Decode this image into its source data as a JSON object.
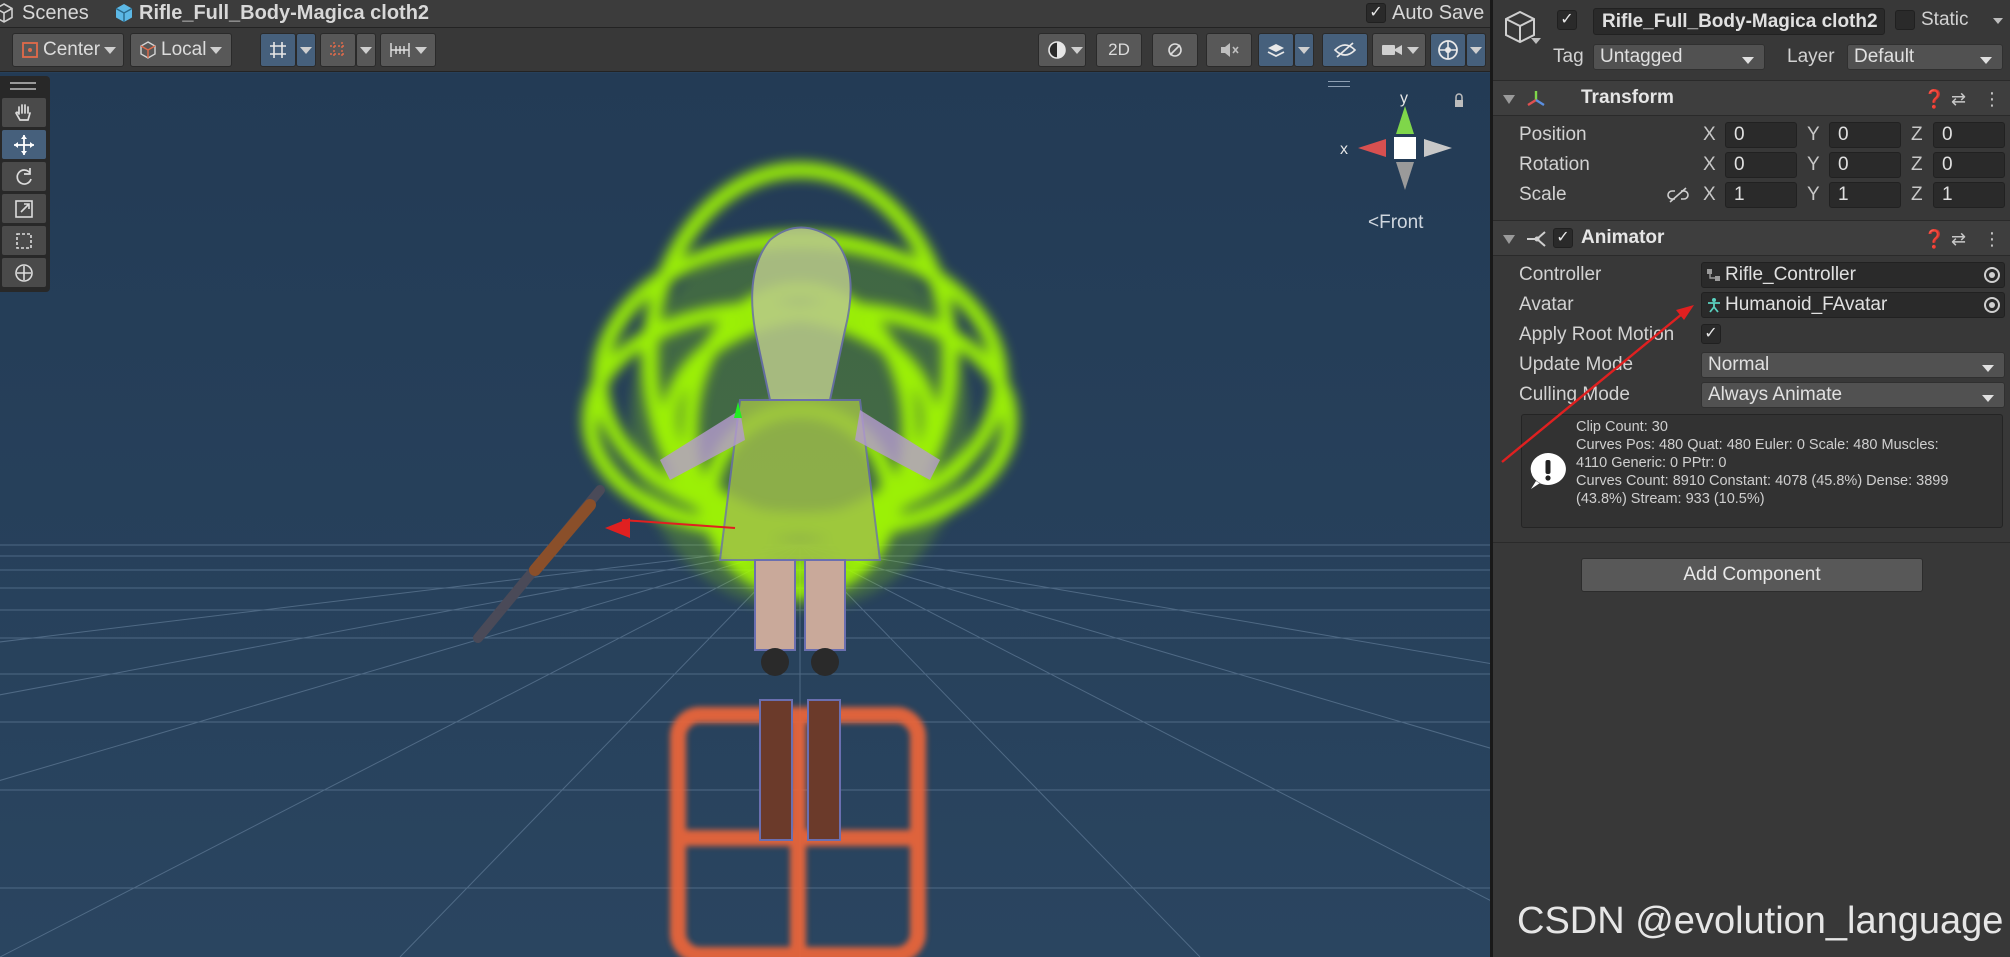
{
  "scene_header": {
    "tab_label": "Scenes",
    "object_label": "Rifle_Full_Body-Magica cloth2",
    "auto_save_label": "Auto Save",
    "auto_save_checked": true
  },
  "scene_toolbar": {
    "pivot_label": "Center",
    "space_label": "Local",
    "mode_2d_label": "2D"
  },
  "gizmo": {
    "y_label": "y",
    "x_label": "x",
    "view_label": "Front"
  },
  "inspector": {
    "object_name": "Rifle_Full_Body-Magica cloth2",
    "active_checked": true,
    "static_label": "Static",
    "tag_label": "Tag",
    "tag_value": "Untagged",
    "layer_label": "Layer",
    "layer_value": "Default",
    "transform": {
      "title": "Transform",
      "position_label": "Position",
      "rotation_label": "Rotation",
      "scale_label": "Scale",
      "axis_x": "X",
      "axis_y": "Y",
      "axis_z": "Z",
      "position": {
        "x": "0",
        "y": "0",
        "z": "0"
      },
      "rotation": {
        "x": "0",
        "y": "0",
        "z": "0"
      },
      "scale": {
        "x": "1",
        "y": "1",
        "z": "1"
      }
    },
    "animator": {
      "title": "Animator",
      "enabled": true,
      "controller_label": "Controller",
      "controller_value": "Rifle_Controller",
      "avatar_label": "Avatar",
      "avatar_value": "Humanoid_FAvatar",
      "apply_root_motion_label": "Apply Root Motion",
      "apply_root_motion_checked": true,
      "update_mode_label": "Update Mode",
      "update_mode_value": "Normal",
      "culling_mode_label": "Culling Mode",
      "culling_mode_value": "Always Animate",
      "info_lines": [
        "Clip Count: 30",
        "Curves Pos: 480 Quat: 480 Euler: 0 Scale: 480 Muscles:",
        "4110 Generic: 0 PPtr: 0",
        "Curves Count: 8910 Constant: 4078 (45.8%) Dense: 3899",
        "(43.8%) Stream: 933 (10.5%)"
      ]
    },
    "add_component_label": "Add Component"
  },
  "watermark": "CSDN @evolution_language",
  "colors": {
    "scene_bg": "#27405a",
    "inspector_bg": "#383838",
    "accent_active": "#46607c",
    "glow_green": "#a6ff00",
    "floor_icon_orange": "#e8653a",
    "annotation_red": "#e02020"
  }
}
